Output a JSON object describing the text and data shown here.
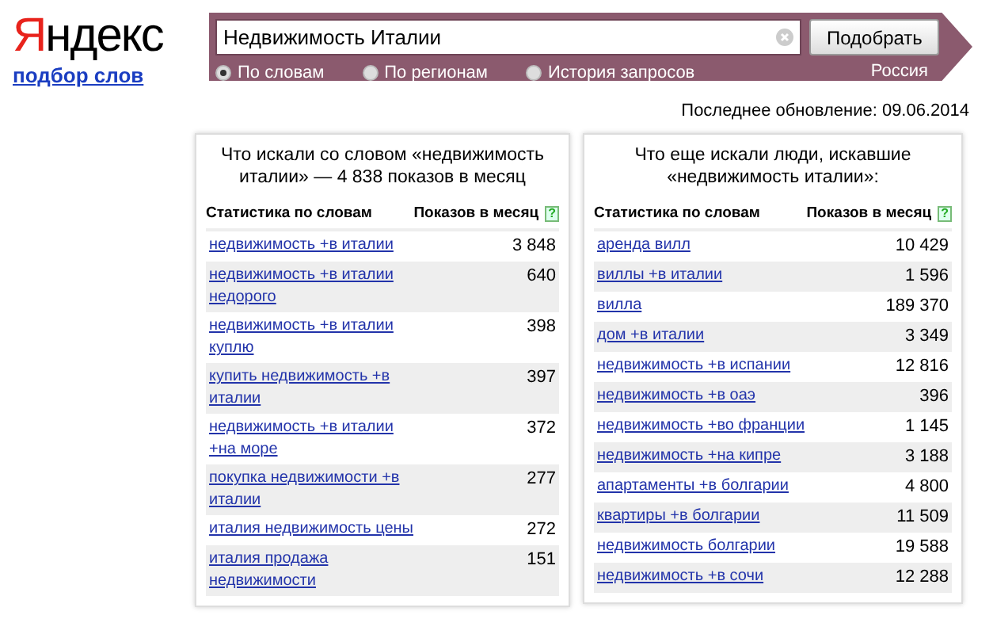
{
  "logo": "Яндекс",
  "subtitle_link": "подбор слов",
  "search": {
    "value": "Недвижимость Италии",
    "button": "Подобрать",
    "region": "Россия",
    "modes": [
      {
        "label": "По словам",
        "selected": true
      },
      {
        "label": "По регионам",
        "selected": false
      },
      {
        "label": "История запросов",
        "selected": false
      }
    ]
  },
  "last_update": "Последнее обновление: 09.06.2014",
  "panels": [
    {
      "title": "Что искали со словом «недвижимость италии» — 4 838 показов в месяц",
      "columns": [
        "Статистика по словам",
        "Показов в месяц"
      ],
      "help": "?",
      "rows": [
        {
          "phrase": "недвижимость +в италии",
          "count": "3 848"
        },
        {
          "phrase": "недвижимость +в италии недорого",
          "count": "640"
        },
        {
          "phrase": "недвижимость +в италии куплю",
          "count": "398"
        },
        {
          "phrase": "купить недвижимость +в италии",
          "count": "397"
        },
        {
          "phrase": "недвижимость +в италии +на море",
          "count": "372"
        },
        {
          "phrase": "покупка недвижимости +в италии",
          "count": "277"
        },
        {
          "phrase": "италия недвижимость цены",
          "count": "272"
        },
        {
          "phrase": "италия продажа недвижимости",
          "count": "151"
        }
      ]
    },
    {
      "title": "Что еще искали люди, искавшие «недвижимость италии»:",
      "columns": [
        "Статистика по словам",
        "Показов в месяц"
      ],
      "help": "?",
      "rows": [
        {
          "phrase": "аренда вилл",
          "count": "10 429"
        },
        {
          "phrase": "виллы +в италии",
          "count": "1 596"
        },
        {
          "phrase": "вилла",
          "count": "189 370"
        },
        {
          "phrase": "дом +в италии",
          "count": "3 349"
        },
        {
          "phrase": "недвижимость +в испании",
          "count": "12 816"
        },
        {
          "phrase": "недвижимость +в оаэ",
          "count": "396"
        },
        {
          "phrase": "недвижимость +во франции",
          "count": "1 145"
        },
        {
          "phrase": "недвижимость +на кипре",
          "count": "3 188"
        },
        {
          "phrase": "апартаменты +в болгарии",
          "count": "4 800"
        },
        {
          "phrase": "квартиры +в болгарии",
          "count": "11 509"
        },
        {
          "phrase": "недвижимость болгарии",
          "count": "19 588"
        },
        {
          "phrase": "недвижимость +в сочи",
          "count": "12 288"
        }
      ]
    }
  ]
}
